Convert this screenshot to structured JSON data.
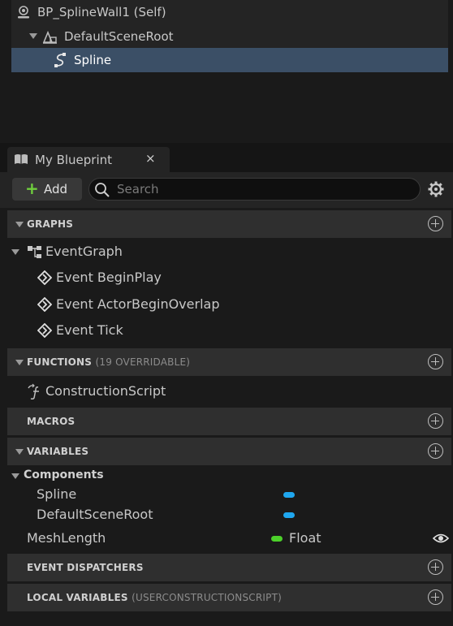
{
  "components": {
    "items": [
      {
        "label": "BP_SplineWall1 (Self)"
      },
      {
        "label": "DefaultSceneRoot"
      },
      {
        "label": "Spline"
      }
    ]
  },
  "tab": {
    "title": "My Blueprint",
    "close": "×"
  },
  "toolbar": {
    "add_label": "Add",
    "search_placeholder": "Search"
  },
  "graphs": {
    "title": "GRAPHS",
    "event_graph": "EventGraph",
    "events": [
      "Event BeginPlay",
      "Event ActorBeginOverlap",
      "Event Tick"
    ]
  },
  "functions": {
    "title": "FUNCTIONS",
    "subtitle": "(19 OVERRIDABLE)",
    "items": [
      "ConstructionScript"
    ]
  },
  "macros": {
    "title": "MACROS"
  },
  "variables": {
    "title": "VARIABLES",
    "category": "Components",
    "component_vars": [
      {
        "name": "Spline",
        "color": "#1fa7ef"
      },
      {
        "name": "DefaultSceneRoot",
        "color": "#1fa7ef"
      }
    ],
    "mesh_length": {
      "name": "MeshLength",
      "type": "Float",
      "color": "#4cd02a"
    }
  },
  "event_dispatchers": {
    "title": "EVENT DISPATCHERS"
  },
  "local_variables": {
    "title": "LOCAL VARIABLES",
    "subtitle": "(USERCONSTRUCTIONSCRIPT)"
  },
  "colors": {
    "selection": "#3b4f66",
    "add_accent": "#6fce3d",
    "object_ref": "#1fa7ef",
    "float": "#4cd02a"
  }
}
